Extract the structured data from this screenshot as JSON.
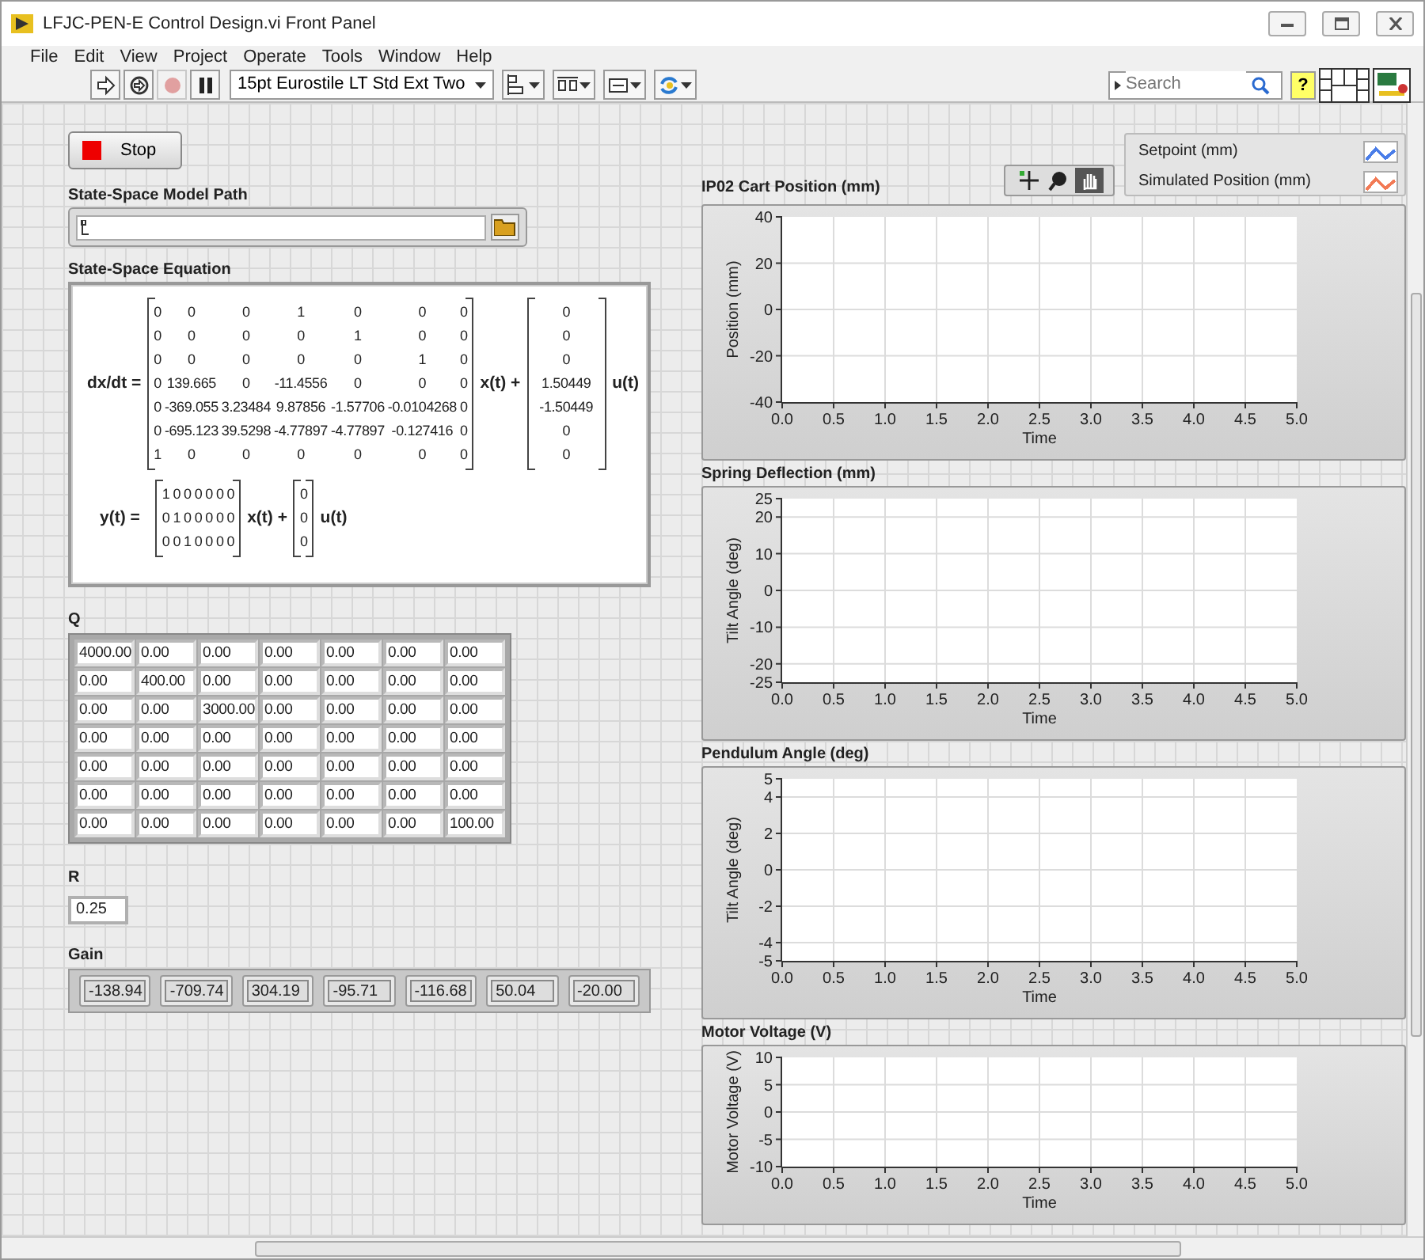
{
  "window": {
    "title": "LFJC-PEN-E Control Design.vi Front Panel"
  },
  "menu": [
    "File",
    "Edit",
    "View",
    "Project",
    "Operate",
    "Tools",
    "Window",
    "Help"
  ],
  "toolbar": {
    "buttons": [
      {
        "kind": "run",
        "disabled": false
      },
      {
        "kind": "run_continuous",
        "disabled": false
      },
      {
        "kind": "abort",
        "disabled": true
      },
      {
        "kind": "pause",
        "disabled": false
      }
    ],
    "font_menu": "15pt Eurostile LT Std Ext Two",
    "tools": [
      {
        "kind": "align"
      },
      {
        "kind": "distribute"
      },
      {
        "kind": "resize"
      },
      {
        "kind": "reorder"
      }
    ],
    "search": {
      "placeholder": "Search"
    },
    "help": "?"
  },
  "stop_button": {
    "label": "Stop"
  },
  "model_path": {
    "label": "State-Space Model Path"
  },
  "equation": {
    "label": "State-Space Equation",
    "lhs1": "dx/dt =",
    "x_term": "x(t) +",
    "u_term": "u(t)",
    "lhs2": "y(t) =",
    "x_term2": "x(t) +",
    "u_term2": "u(t)",
    "A": [
      [
        "0",
        "0",
        "0",
        "1",
        "0",
        "0",
        "0"
      ],
      [
        "0",
        "0",
        "0",
        "0",
        "1",
        "0",
        "0"
      ],
      [
        "0",
        "0",
        "0",
        "0",
        "0",
        "1",
        "0"
      ],
      [
        "0",
        "139.665",
        "0",
        "-11.4556",
        "0",
        "0",
        "0"
      ],
      [
        "0",
        "-369.055",
        "3.23484",
        "9.87856",
        "-1.57706",
        "-0.0104268",
        "0"
      ],
      [
        "0",
        "-695.123",
        "39.5298",
        "-4.77897",
        "-4.77897",
        "-0.127416",
        "0"
      ],
      [
        "1",
        "0",
        "0",
        "0",
        "0",
        "0",
        "0"
      ]
    ],
    "B": [
      [
        "0"
      ],
      [
        "0"
      ],
      [
        "0"
      ],
      [
        "1.50449"
      ],
      [
        "-1.50449"
      ],
      [
        "0"
      ],
      [
        "0"
      ]
    ],
    "C": [
      [
        "1",
        "0",
        "0",
        "0",
        "0",
        "0",
        "0"
      ],
      [
        "0",
        "1",
        "0",
        "0",
        "0",
        "0",
        "0"
      ],
      [
        "0",
        "0",
        "1",
        "0",
        "0",
        "0",
        "0"
      ]
    ],
    "D": [
      [
        "0"
      ],
      [
        "0"
      ],
      [
        "0"
      ]
    ]
  },
  "Q": {
    "label": "Q",
    "rows": [
      [
        "4000.00",
        "0.00",
        "0.00",
        "0.00",
        "0.00",
        "0.00",
        "0.00"
      ],
      [
        "0.00",
        "400.00",
        "0.00",
        "0.00",
        "0.00",
        "0.00",
        "0.00"
      ],
      [
        "0.00",
        "0.00",
        "3000.00",
        "0.00",
        "0.00",
        "0.00",
        "0.00"
      ],
      [
        "0.00",
        "0.00",
        "0.00",
        "0.00",
        "0.00",
        "0.00",
        "0.00"
      ],
      [
        "0.00",
        "0.00",
        "0.00",
        "0.00",
        "0.00",
        "0.00",
        "0.00"
      ],
      [
        "0.00",
        "0.00",
        "0.00",
        "0.00",
        "0.00",
        "0.00",
        "0.00"
      ],
      [
        "0.00",
        "0.00",
        "0.00",
        "0.00",
        "0.00",
        "0.00",
        "100.00"
      ]
    ]
  },
  "R": {
    "label": "R",
    "value": "0.25"
  },
  "gain": {
    "label": "Gain",
    "values": [
      "-138.94",
      "-709.74",
      "304.19",
      "-95.71",
      "-116.68",
      "50.04",
      "-20.00"
    ]
  },
  "graph_palette": [
    {
      "kind": "cursor",
      "selected": false
    },
    {
      "kind": "zoom",
      "selected": false
    },
    {
      "kind": "pan",
      "selected": true
    }
  ],
  "legend": [
    {
      "name": "Setpoint (mm)",
      "color": "#4a7de8"
    },
    {
      "name": "Simulated Position (mm)",
      "color": "#f27a55"
    }
  ],
  "graphs": [
    {
      "label": "IP02 Cart Position (mm)",
      "chart_data": {
        "type": "line",
        "grid": true,
        "xlabel": "Time",
        "ylabel": "Position (mm)",
        "xlim": [
          0,
          5
        ],
        "ylim": [
          -40,
          40
        ],
        "xticks": [
          {
            "value": 0,
            "label": "0.0"
          },
          {
            "value": 0.5,
            "label": "0.5"
          },
          {
            "value": 1,
            "label": "1.0"
          },
          {
            "value": 1.5,
            "label": "1.5"
          },
          {
            "value": 2,
            "label": "2.0"
          },
          {
            "value": 2.5,
            "label": "2.5"
          },
          {
            "value": 3,
            "label": "3.0"
          },
          {
            "value": 3.5,
            "label": "3.5"
          },
          {
            "value": 4,
            "label": "4.0"
          },
          {
            "value": 4.5,
            "label": "4.5"
          },
          {
            "value": 5,
            "label": "5.0"
          }
        ],
        "yticks": [
          40,
          20,
          0,
          -20,
          -40
        ]
      }
    },
    {
      "label": "Spring Deflection (mm)",
      "chart_data": {
        "type": "line",
        "grid": true,
        "xlabel": "Time",
        "ylabel": "Tilt Angle (deg)",
        "xlim": [
          0,
          5
        ],
        "ylim": [
          -25,
          25
        ],
        "xticks": [
          {
            "value": 0,
            "label": "0.0"
          },
          {
            "value": 0.5,
            "label": "0.5"
          },
          {
            "value": 1,
            "label": "1.0"
          },
          {
            "value": 1.5,
            "label": "1.5"
          },
          {
            "value": 2,
            "label": "2.0"
          },
          {
            "value": 2.5,
            "label": "2.5"
          },
          {
            "value": 3,
            "label": "3.0"
          },
          {
            "value": 3.5,
            "label": "3.5"
          },
          {
            "value": 4,
            "label": "4.0"
          },
          {
            "value": 4.5,
            "label": "4.5"
          },
          {
            "value": 5,
            "label": "5.0"
          }
        ],
        "yticks": [
          25,
          20,
          10,
          0,
          -10,
          -20,
          -25
        ]
      }
    },
    {
      "label": "Pendulum Angle (deg)",
      "chart_data": {
        "type": "line",
        "grid": true,
        "xlabel": "Time",
        "ylabel": "Tilt Angle (deg)",
        "xlim": [
          0,
          5
        ],
        "ylim": [
          -5,
          5
        ],
        "xticks": [
          {
            "value": 0,
            "label": "0.0"
          },
          {
            "value": 0.5,
            "label": "0.5"
          },
          {
            "value": 1,
            "label": "1.0"
          },
          {
            "value": 1.5,
            "label": "1.5"
          },
          {
            "value": 2,
            "label": "2.0"
          },
          {
            "value": 2.5,
            "label": "2.5"
          },
          {
            "value": 3,
            "label": "3.0"
          },
          {
            "value": 3.5,
            "label": "3.5"
          },
          {
            "value": 4,
            "label": "4.0"
          },
          {
            "value": 4.5,
            "label": "4.5"
          },
          {
            "value": 5,
            "label": "5.0"
          }
        ],
        "yticks": [
          5,
          4,
          2,
          0,
          -2,
          -4,
          -5
        ]
      }
    },
    {
      "label": "Motor Voltage (V)",
      "chart_data": {
        "type": "line",
        "grid": true,
        "xlabel": "Time",
        "ylabel": "Motor Voltage (V)",
        "xlim": [
          0,
          5
        ],
        "ylim": [
          -10,
          10
        ],
        "xticks": [
          {
            "value": 0,
            "label": "0.0"
          },
          {
            "value": 0.5,
            "label": "0.5"
          },
          {
            "value": 1,
            "label": "1.0"
          },
          {
            "value": 1.5,
            "label": "1.5"
          },
          {
            "value": 2,
            "label": "2.0"
          },
          {
            "value": 2.5,
            "label": "2.5"
          },
          {
            "value": 3,
            "label": "3.0"
          },
          {
            "value": 3.5,
            "label": "3.5"
          },
          {
            "value": 4,
            "label": "4.0"
          },
          {
            "value": 4.5,
            "label": "4.5"
          },
          {
            "value": 5,
            "label": "5.0"
          }
        ],
        "yticks": [
          10,
          5,
          0,
          -5,
          -10
        ]
      }
    }
  ]
}
